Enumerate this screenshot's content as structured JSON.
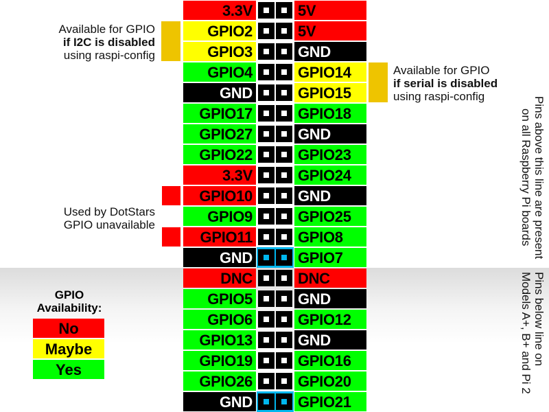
{
  "colors": {
    "no": "#ff0000",
    "maybe": "#ffff00",
    "yes": "#00ff00",
    "power": "#ff0000",
    "ground": "#000000",
    "annotation_bar": "#eec400",
    "ground_pin_highlight": "#00b7ee"
  },
  "pins": [
    {
      "left": "3.3V",
      "left_type": "power",
      "right": "5V",
      "right_type": "power",
      "highlight": false
    },
    {
      "left": "GPIO2",
      "left_type": "maybe",
      "right": "5V",
      "right_type": "power",
      "highlight": false
    },
    {
      "left": "GPIO3",
      "left_type": "maybe",
      "right": "GND",
      "right_type": "ground",
      "highlight": false
    },
    {
      "left": "GPIO4",
      "left_type": "yes",
      "right": "GPIO14",
      "right_type": "maybe",
      "highlight": false
    },
    {
      "left": "GND",
      "left_type": "ground",
      "right": "GPIO15",
      "right_type": "maybe",
      "highlight": false
    },
    {
      "left": "GPIO17",
      "left_type": "yes",
      "right": "GPIO18",
      "right_type": "yes",
      "highlight": false
    },
    {
      "left": "GPIO27",
      "left_type": "yes",
      "right": "GND",
      "right_type": "ground",
      "highlight": false
    },
    {
      "left": "GPIO22",
      "left_type": "yes",
      "right": "GPIO23",
      "right_type": "yes",
      "highlight": false
    },
    {
      "left": "3.3V",
      "left_type": "power",
      "right": "GPIO24",
      "right_type": "yes",
      "highlight": false
    },
    {
      "left": "GPIO10",
      "left_type": "no",
      "right": "GND",
      "right_type": "ground",
      "highlight": false
    },
    {
      "left": "GPIO9",
      "left_type": "yes",
      "right": "GPIO25",
      "right_type": "yes",
      "highlight": false
    },
    {
      "left": "GPIO11",
      "left_type": "no",
      "right": "GPIO8",
      "right_type": "yes",
      "highlight": false
    },
    {
      "left": "GND",
      "left_type": "ground",
      "right": "GPIO7",
      "right_type": "yes",
      "highlight": true
    },
    {
      "left": "DNC",
      "left_type": "power",
      "right": "DNC",
      "right_type": "power",
      "highlight": false
    },
    {
      "left": "GPIO5",
      "left_type": "yes",
      "right": "GND",
      "right_type": "ground",
      "highlight": false
    },
    {
      "left": "GPIO6",
      "left_type": "yes",
      "right": "GPIO12",
      "right_type": "yes",
      "highlight": false
    },
    {
      "left": "GPIO13",
      "left_type": "yes",
      "right": "GND",
      "right_type": "ground",
      "highlight": false
    },
    {
      "left": "GPIO19",
      "left_type": "yes",
      "right": "GPIO16",
      "right_type": "yes",
      "highlight": false
    },
    {
      "left": "GPIO26",
      "left_type": "yes",
      "right": "GPIO20",
      "right_type": "yes",
      "highlight": false
    },
    {
      "left": "GND",
      "left_type": "ground",
      "right": "GPIO21",
      "right_type": "yes",
      "highlight": true
    }
  ],
  "annotations": {
    "i2c": {
      "line1": "Available for GPIO",
      "line2": "if I2C is disabled",
      "line3": "using raspi-config"
    },
    "serial": {
      "line1": "Available for GPIO",
      "line2": "if serial is disabled",
      "line3": "using raspi-config"
    },
    "dotstars": {
      "line1": "Used by DotStars",
      "line2": "GPIO unavailable"
    }
  },
  "side_notes": {
    "above": {
      "line1": "Pins above this line are present",
      "line2": "on all Raspberry Pi boards"
    },
    "below": {
      "line1": "Pins below line on",
      "line2": "Models A+, B+ and Pi 2"
    }
  },
  "legend": {
    "title_line1": "GPIO",
    "title_line2": "Availability:",
    "items": [
      {
        "label": "No",
        "type": "no"
      },
      {
        "label": "Maybe",
        "type": "maybe"
      },
      {
        "label": "Yes",
        "type": "yes"
      }
    ]
  }
}
